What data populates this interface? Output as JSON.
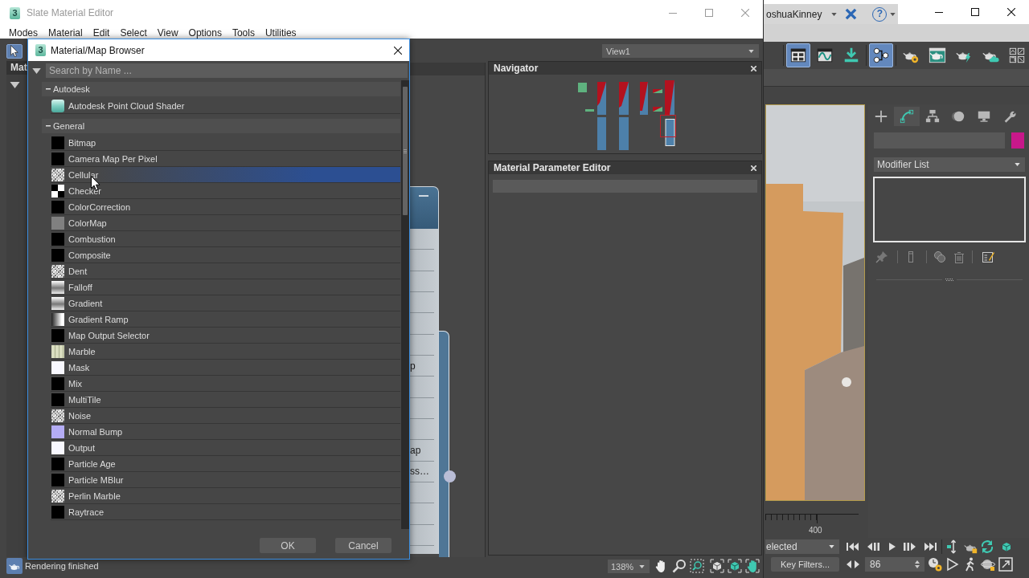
{
  "slate": {
    "logo": "3",
    "title": "Slate Material Editor",
    "menu": [
      "Modes",
      "Material",
      "Edit",
      "Select",
      "View",
      "Options",
      "Tools",
      "Utilities"
    ],
    "select_tool": {
      "on": true
    },
    "view_dropdown": "View1",
    "panel_tab": "Mat",
    "node": {
      "slots": [
        {
          "kind": "blank"
        },
        {
          "kind": "blank"
        },
        {
          "kind": "blank"
        },
        {
          "kind": "blank"
        },
        {
          "kind": "blank"
        },
        {
          "kind": "blank"
        },
        {
          "kind": "labeled",
          "label": "p"
        },
        {
          "kind": "blank"
        },
        {
          "kind": "blank"
        },
        {
          "kind": "blank"
        },
        {
          "kind": "labeled",
          "label": "ap"
        },
        {
          "kind": "labeled",
          "label": "ss…"
        },
        {
          "kind": "blank"
        },
        {
          "kind": "blank"
        },
        {
          "kind": "blank"
        },
        {
          "kind": "blank"
        }
      ]
    },
    "navigator": {
      "title": "Navigator"
    },
    "parameter_editor": {
      "title": "Material Parameter Editor"
    },
    "status": "Rendering finished",
    "zoom": "138%"
  },
  "browser": {
    "logo": "3",
    "title": "Material/Map Browser",
    "search": {
      "placeholder": "Search by Name ..."
    },
    "groups": [
      {
        "label": "Autodesk",
        "expanded": true,
        "children": [
          {
            "label": "Autodesk Point Cloud Shader",
            "kind": "cloud",
            "selected": false
          }
        ]
      },
      {
        "label": "General",
        "expanded": true,
        "children": [
          {
            "label": "Bitmap",
            "kind": "solid",
            "color": "#000000",
            "selected": false
          },
          {
            "label": "Camera Map Per Pixel",
            "kind": "solid",
            "color": "#000000",
            "selected": false
          },
          {
            "label": "Cellular",
            "kind": "speckle",
            "selected": true
          },
          {
            "label": "Checker",
            "kind": "checker",
            "selected": false
          },
          {
            "label": "ColorCorrection",
            "kind": "solid",
            "color": "#000000",
            "selected": false
          },
          {
            "label": "ColorMap",
            "kind": "solid",
            "color": "#808080",
            "selected": false
          },
          {
            "label": "Combustion",
            "kind": "solid",
            "color": "#000000",
            "selected": false
          },
          {
            "label": "Composite",
            "kind": "solid",
            "color": "#000000",
            "selected": false
          },
          {
            "label": "Dent",
            "kind": "speckle",
            "selected": false
          },
          {
            "label": "Falloff",
            "kind": "gradient",
            "selected": false
          },
          {
            "label": "Gradient",
            "kind": "gradient",
            "selected": false
          },
          {
            "label": "Gradient Ramp",
            "kind": "ramp",
            "selected": false
          },
          {
            "label": "Map Output Selector",
            "kind": "solid",
            "color": "#000000",
            "selected": false
          },
          {
            "label": "Marble",
            "kind": "marble",
            "selected": false
          },
          {
            "label": "Mask",
            "kind": "solid",
            "color": "#f8f8ff",
            "selected": false
          },
          {
            "label": "Mix",
            "kind": "solid",
            "color": "#000000",
            "selected": false
          },
          {
            "label": "MultiTile",
            "kind": "solid",
            "color": "#000000",
            "selected": false
          },
          {
            "label": "Noise",
            "kind": "speckle",
            "selected": false
          },
          {
            "label": "Normal Bump",
            "kind": "solid",
            "color": "#b4acf4",
            "selected": false
          },
          {
            "label": "Output",
            "kind": "solid",
            "color": "#f8f8ff",
            "selected": false
          },
          {
            "label": "Particle Age",
            "kind": "solid",
            "color": "#000000",
            "selected": false
          },
          {
            "label": "Particle MBlur",
            "kind": "solid",
            "color": "#000000",
            "selected": false
          },
          {
            "label": "Perlin Marble",
            "kind": "speckle",
            "selected": false
          },
          {
            "label": "Raytrace",
            "kind": "solid",
            "color": "#000000",
            "selected": false
          }
        ]
      }
    ],
    "buttons": [
      "OK",
      "Cancel"
    ]
  },
  "app": {
    "user": "oshuaKinney",
    "help_button": "?",
    "toolbar": [
      {
        "kind": "panels",
        "on": true
      },
      {
        "kind": "curve",
        "on": false
      },
      {
        "kind": "download",
        "on": false
      },
      {
        "kind": "schematic",
        "on": true
      },
      {
        "kind": "gear",
        "on": false
      },
      {
        "kind": "frame",
        "on": false
      },
      {
        "kind": "render",
        "on": false
      },
      {
        "kind": "cloud",
        "on": false
      },
      {
        "kind": "grid",
        "on": false
      }
    ],
    "command_tabs": [
      {
        "kind": "create",
        "selected": false
      },
      {
        "kind": "modify",
        "selected": true
      },
      {
        "kind": "hierarchy",
        "selected": false
      },
      {
        "kind": "motion",
        "selected": false
      },
      {
        "kind": "display",
        "selected": false
      },
      {
        "kind": "utilities",
        "selected": false
      }
    ],
    "modifier_list": "Modifier List",
    "timeline_label": "400",
    "selection_set": "elected",
    "key_filters": "Key Filters...",
    "frame": "86"
  }
}
